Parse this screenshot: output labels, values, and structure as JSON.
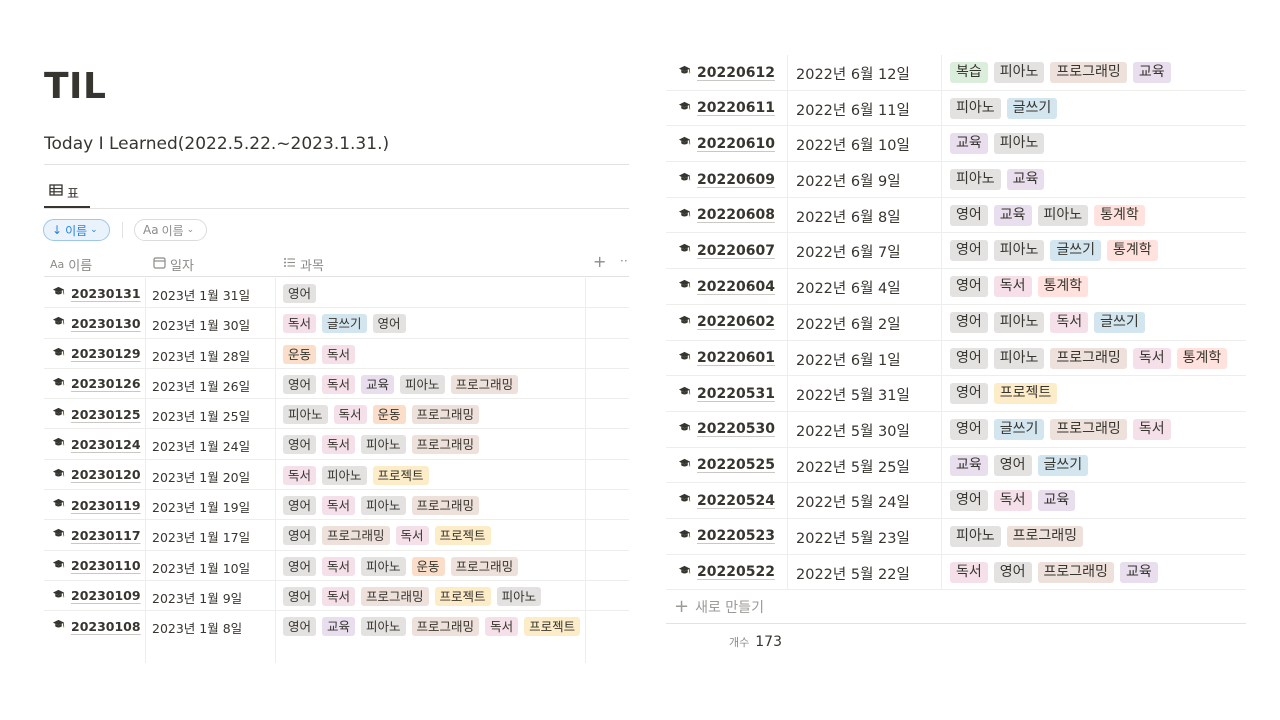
{
  "page": {
    "title": "TIL",
    "subtitle": "Today I Learned(2022.5.22.~2023.1.31.)"
  },
  "view_tab": {
    "label": "표"
  },
  "toolbar": {
    "sort_label": "이름",
    "filter_label": "이름",
    "filter_prefix": "Aa"
  },
  "columns": {
    "name_prefix": "Aa",
    "name": "이름",
    "date": "일자",
    "subject": "과목",
    "add": "+",
    "more": "··"
  },
  "tag_colors": {
    "영어": "#e3e2e0",
    "독서": "#f5e0e9",
    "글쓰기": "#d3e5ef",
    "운동": "#fadec9",
    "교육": "#e8deee",
    "피아노": "#e3e2e0",
    "프로그래밍": "#eee0da",
    "프로젝트": "#fdecc8",
    "복습": "#dbeddb",
    "통계학": "#ffe2dd"
  },
  "left_rows": [
    {
      "name": "20230131",
      "date": "2023년 1월 31일",
      "tags": [
        "영어"
      ]
    },
    {
      "name": "20230130",
      "date": "2023년 1월 30일",
      "tags": [
        "독서",
        "글쓰기",
        "영어"
      ]
    },
    {
      "name": "20230129",
      "date": "2023년 1월 28일",
      "tags": [
        "운동",
        "독서"
      ]
    },
    {
      "name": "20230126",
      "date": "2023년 1월 26일",
      "tags": [
        "영어",
        "독서",
        "교육",
        "피아노",
        "프로그래밍"
      ]
    },
    {
      "name": "20230125",
      "date": "2023년 1월 25일",
      "tags": [
        "피아노",
        "독서",
        "운동",
        "프로그래밍"
      ]
    },
    {
      "name": "20230124",
      "date": "2023년 1월 24일",
      "tags": [
        "영어",
        "독서",
        "피아노",
        "프로그래밍"
      ]
    },
    {
      "name": "20230120",
      "date": "2023년 1월 20일",
      "tags": [
        "독서",
        "피아노",
        "프로젝트"
      ]
    },
    {
      "name": "20230119",
      "date": "2023년 1월 19일",
      "tags": [
        "영어",
        "독서",
        "피아노",
        "프로그래밍"
      ]
    },
    {
      "name": "20230117",
      "date": "2023년 1월 17일",
      "tags": [
        "영어",
        "프로그래밍",
        "독서",
        "프로젝트"
      ]
    },
    {
      "name": "20230110",
      "date": "2023년 1월 10일",
      "tags": [
        "영어",
        "독서",
        "피아노",
        "운동",
        "프로그래밍"
      ]
    },
    {
      "name": "20230109",
      "date": "2023년 1월 9일",
      "tags": [
        "영어",
        "독서",
        "프로그래밍",
        "프로젝트",
        "피아노"
      ]
    },
    {
      "name": "20230108",
      "date": "2023년 1월 8일",
      "tags": [
        "영어",
        "교육",
        "피아노",
        "프로그래밍",
        "독서",
        "프로젝트"
      ]
    }
  ],
  "right_rows": [
    {
      "name": "20220612",
      "date": "2022년 6월 12일",
      "tags": [
        "복습",
        "피아노",
        "프로그래밍",
        "교육"
      ]
    },
    {
      "name": "20220611",
      "date": "2022년 6월 11일",
      "tags": [
        "피아노",
        "글쓰기"
      ]
    },
    {
      "name": "20220610",
      "date": "2022년 6월 10일",
      "tags": [
        "교육",
        "피아노"
      ]
    },
    {
      "name": "20220609",
      "date": "2022년 6월 9일",
      "tags": [
        "피아노",
        "교육"
      ]
    },
    {
      "name": "20220608",
      "date": "2022년 6월 8일",
      "tags": [
        "영어",
        "교육",
        "피아노",
        "통계학"
      ]
    },
    {
      "name": "20220607",
      "date": "2022년 6월 7일",
      "tags": [
        "영어",
        "피아노",
        "글쓰기",
        "통계학"
      ]
    },
    {
      "name": "20220604",
      "date": "2022년 6월 4일",
      "tags": [
        "영어",
        "독서",
        "통계학"
      ]
    },
    {
      "name": "20220602",
      "date": "2022년 6월 2일",
      "tags": [
        "영어",
        "피아노",
        "독서",
        "글쓰기"
      ]
    },
    {
      "name": "20220601",
      "date": "2022년 6월 1일",
      "tags": [
        "영어",
        "피아노",
        "프로그래밍",
        "독서",
        "통계학"
      ]
    },
    {
      "name": "20220531",
      "date": "2022년 5월 31일",
      "tags": [
        "영어",
        "프로젝트"
      ]
    },
    {
      "name": "20220530",
      "date": "2022년 5월 30일",
      "tags": [
        "영어",
        "글쓰기",
        "프로그래밍",
        "독서"
      ]
    },
    {
      "name": "20220525",
      "date": "2022년 5월 25일",
      "tags": [
        "교육",
        "영어",
        "글쓰기"
      ]
    },
    {
      "name": "20220524",
      "date": "2022년 5월 24일",
      "tags": [
        "영어",
        "독서",
        "교육"
      ]
    },
    {
      "name": "20220523",
      "date": "2022년 5월 23일",
      "tags": [
        "피아노",
        "프로그래밍"
      ]
    },
    {
      "name": "20220522",
      "date": "2022년 5월 22일",
      "tags": [
        "독서",
        "영어",
        "프로그래밍",
        "교육"
      ]
    }
  ],
  "footer": {
    "new_label": "새로 만들기",
    "count_label": "개수",
    "count_value": "173"
  },
  "icons": {
    "row_icon": "graduation-cap-icon",
    "table_icon": "table-icon",
    "calendar_icon": "calendar-icon",
    "list_icon": "list-icon"
  }
}
